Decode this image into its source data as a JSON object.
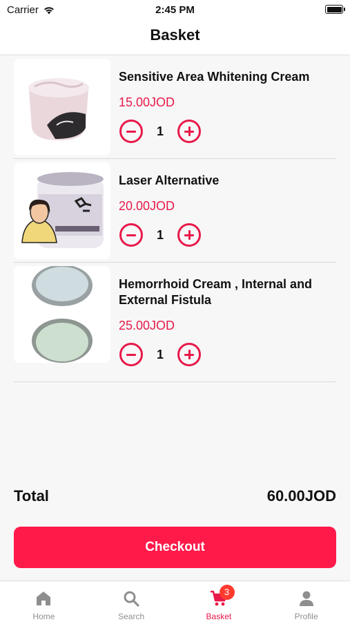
{
  "status_bar": {
    "carrier": "Carrier",
    "time": "2:45 PM"
  },
  "header": {
    "title": "Basket"
  },
  "basket": {
    "items": [
      {
        "name": "Sensitive Area Whitening Cream",
        "price": "15.00JOD",
        "quantity": "1"
      },
      {
        "name": "Laser Alternative",
        "price": "20.00JOD",
        "quantity": "1"
      },
      {
        "name": "Hemorrhoid Cream , Internal and External Fistula",
        "price": "25.00JOD",
        "quantity": "1"
      }
    ],
    "total_label": "Total",
    "total_value": "60.00JOD",
    "checkout_label": "Checkout"
  },
  "tabbar": {
    "tabs": [
      {
        "label": "Home",
        "icon": "home-icon"
      },
      {
        "label": "Search",
        "icon": "search-icon"
      },
      {
        "label": "Basket",
        "icon": "cart-icon",
        "badge": "3",
        "active": true
      },
      {
        "label": "Profile",
        "icon": "person-icon"
      }
    ]
  },
  "colors": {
    "accent": "#ff1a4a",
    "price": "#e8194a",
    "badge": "#ff3b30",
    "inactive": "#8e8e8e"
  }
}
